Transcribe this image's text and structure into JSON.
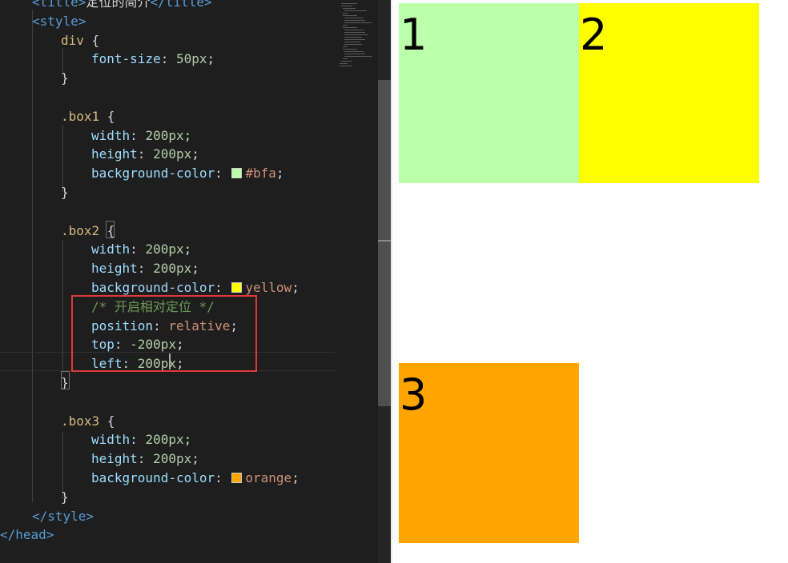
{
  "editor": {
    "lines": [
      [
        [
          "tag",
          "<title>"
        ],
        [
          "txt",
          "定位的简介"
        ],
        [
          "tag",
          "</title>"
        ]
      ],
      [
        [
          "tag",
          "<style>"
        ]
      ],
      [
        [
          "sel",
          "div"
        ],
        [
          "txt",
          " {"
        ]
      ],
      [
        [
          "prop",
          "font-size"
        ],
        [
          "txt",
          ": "
        ],
        [
          "num",
          "50px"
        ],
        [
          "txt",
          ";"
        ]
      ],
      [
        [
          "txt",
          "}"
        ]
      ],
      [],
      [
        [
          "sel",
          ".box1"
        ],
        [
          "txt",
          " {"
        ]
      ],
      [
        [
          "prop",
          "width"
        ],
        [
          "txt",
          ": "
        ],
        [
          "num",
          "200px"
        ],
        [
          "txt",
          ";"
        ]
      ],
      [
        [
          "prop",
          "height"
        ],
        [
          "txt",
          ": "
        ],
        [
          "num",
          "200px"
        ],
        [
          "txt",
          ";"
        ]
      ],
      [
        [
          "prop",
          "background-color"
        ],
        [
          "txt",
          ": "
        ],
        [
          "swatch",
          "#bbffaa"
        ],
        [
          "str",
          "#bfa"
        ],
        [
          "txt",
          ";"
        ]
      ],
      [
        [
          "txt",
          "}"
        ]
      ],
      [],
      [
        [
          "sel",
          ".box2"
        ],
        [
          "txt",
          " {"
        ]
      ],
      [
        [
          "prop",
          "width"
        ],
        [
          "txt",
          ": "
        ],
        [
          "num",
          "200px"
        ],
        [
          "txt",
          ";"
        ]
      ],
      [
        [
          "prop",
          "height"
        ],
        [
          "txt",
          ": "
        ],
        [
          "num",
          "200px"
        ],
        [
          "txt",
          ";"
        ]
      ],
      [
        [
          "prop",
          "background-color"
        ],
        [
          "txt",
          ": "
        ],
        [
          "swatch",
          "#ffff00"
        ],
        [
          "str",
          "yellow"
        ],
        [
          "txt",
          ";"
        ]
      ],
      [
        [
          "com",
          "/* 开启相对定位 */"
        ]
      ],
      [
        [
          "prop",
          "position"
        ],
        [
          "txt",
          ": "
        ],
        [
          "str",
          "relative"
        ],
        [
          "txt",
          ";"
        ]
      ],
      [
        [
          "prop",
          "top"
        ],
        [
          "txt",
          ": "
        ],
        [
          "num",
          "-200px"
        ],
        [
          "txt",
          ";"
        ]
      ],
      [
        [
          "prop",
          "left"
        ],
        [
          "txt",
          ": "
        ],
        [
          "num",
          "200px"
        ],
        [
          "txt",
          ";"
        ]
      ],
      [
        [
          "txt",
          "}"
        ]
      ],
      [],
      [
        [
          "sel",
          ".box3"
        ],
        [
          "txt",
          " {"
        ]
      ],
      [
        [
          "prop",
          "width"
        ],
        [
          "txt",
          ": "
        ],
        [
          "num",
          "200px"
        ],
        [
          "txt",
          ";"
        ]
      ],
      [
        [
          "prop",
          "height"
        ],
        [
          "txt",
          ": "
        ],
        [
          "num",
          "200px"
        ],
        [
          "txt",
          ";"
        ]
      ],
      [
        [
          "prop",
          "background-color"
        ],
        [
          "txt",
          ": "
        ],
        [
          "swatch",
          "#ffa500"
        ],
        [
          "str",
          "orange"
        ],
        [
          "txt",
          ";"
        ]
      ],
      [
        [
          "txt",
          "}"
        ]
      ],
      [
        [
          "tag",
          "</style>"
        ]
      ],
      [
        [
          "tag",
          "</head>"
        ]
      ]
    ]
  },
  "preview": {
    "box1": {
      "label": "1",
      "color": "#bbffaa"
    },
    "box2": {
      "label": "2",
      "color": "#ffff00"
    },
    "box3": {
      "label": "3",
      "color": "#ffa500"
    }
  },
  "colors": {
    "editor_bg": "#1e1e1e",
    "highlight_border": "#e0383a"
  }
}
